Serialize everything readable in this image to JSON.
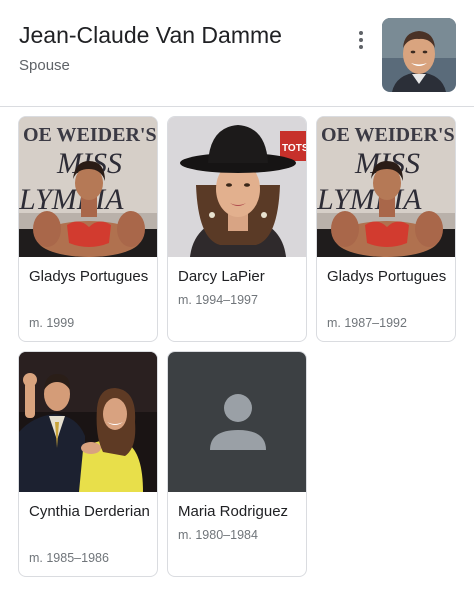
{
  "header": {
    "title": "Jean-Claude Van Damme",
    "subtitle": "Spouse",
    "more_icon": "more-vert-icon"
  },
  "spouses": [
    {
      "name": "Gladys Portugues",
      "years": "m. 1999",
      "photo": "photo"
    },
    {
      "name": "Darcy LaPier",
      "years": "m. 1994–1997",
      "photo": "photo"
    },
    {
      "name": "Gladys Portugues",
      "years": "m. 1987–1992",
      "photo": "photo"
    },
    {
      "name": "Cynthia Derderian",
      "years": "m. 1985–1986",
      "photo": "photo"
    },
    {
      "name": "Maria Rodriguez",
      "years": "m. 1980–1984",
      "photo": "person-placeholder-icon"
    }
  ],
  "photo_text": {
    "banner_line1": "OE WEIDER'S",
    "banner_line2": "MISS",
    "banner_line3": "LYMPIA",
    "sign": "TOTS"
  },
  "colors": {
    "text": "#202124",
    "secondary": "#70757a",
    "border": "#dadce0",
    "placeholder_bg": "#3c4043",
    "placeholder_icon": "#9aa0a6"
  }
}
